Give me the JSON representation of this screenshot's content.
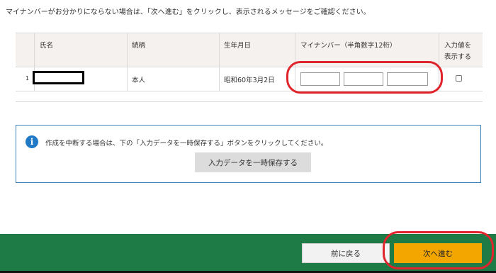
{
  "instruction": "マイナンバーがお分かりにならない場合は、「次へ進む」をクリックし、表示されるメッセージをご確認ください。",
  "table": {
    "headers": {
      "name": "氏名",
      "relation": "続柄",
      "birthdate": "生年月日",
      "mynumber": "マイナンバー（半角数字12桁）",
      "show_input_line1": "入力値を",
      "show_input_line2": "表示する"
    },
    "rows": [
      {
        "index": "1",
        "name": "",
        "relation": "本人",
        "birthdate": "昭和60年3月2日",
        "mynumber_parts": [
          "",
          "",
          ""
        ],
        "show_input": false
      }
    ]
  },
  "info": {
    "icon": "info-icon",
    "message": "作成を中断する場合は、下の「入力データを一時保存する」ボタンをクリックしてください。",
    "save_button": "入力データを一時保存する"
  },
  "footer": {
    "back_button": "前に戻る",
    "next_button": "次へ進む"
  },
  "colors": {
    "footer_bg": "#1e7b46",
    "next_button_bg": "#f3a600",
    "info_border": "#3a82b7",
    "annotation_red": "#e0242c",
    "table_header_bg": "#f4f1ee"
  }
}
